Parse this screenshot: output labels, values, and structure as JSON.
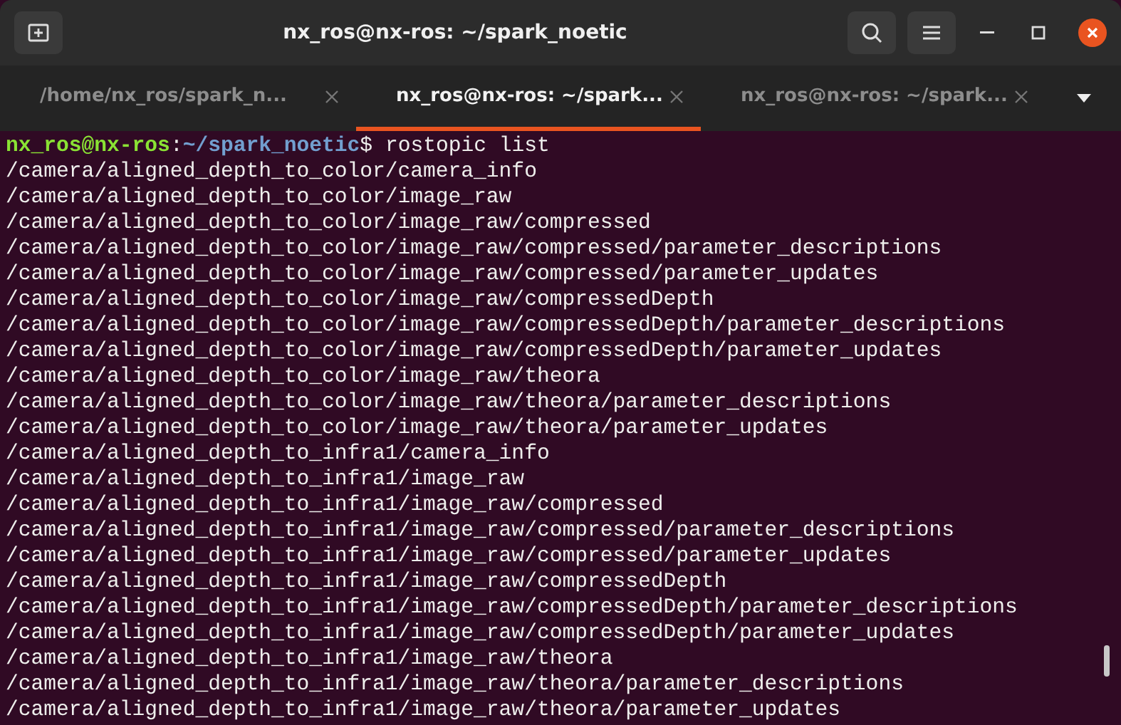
{
  "window": {
    "title": "nx_ros@nx-ros: ~/spark_noetic"
  },
  "tabs": [
    {
      "label": "/home/nx_ros/spark_n...",
      "selected": false
    },
    {
      "label": "nx_ros@nx-ros: ~/spark...",
      "selected": true
    },
    {
      "label": "nx_ros@nx-ros: ~/spark...",
      "selected": false
    }
  ],
  "terminal": {
    "prompt": {
      "user_host": "nx_ros@nx-ros",
      "separator": ":",
      "path": "~/spark_noetic",
      "symbol": "$",
      "command": "rostopic list"
    },
    "lines": [
      "/camera/aligned_depth_to_color/camera_info",
      "/camera/aligned_depth_to_color/image_raw",
      "/camera/aligned_depth_to_color/image_raw/compressed",
      "/camera/aligned_depth_to_color/image_raw/compressed/parameter_descriptions",
      "/camera/aligned_depth_to_color/image_raw/compressed/parameter_updates",
      "/camera/aligned_depth_to_color/image_raw/compressedDepth",
      "/camera/aligned_depth_to_color/image_raw/compressedDepth/parameter_descriptions",
      "/camera/aligned_depth_to_color/image_raw/compressedDepth/parameter_updates",
      "/camera/aligned_depth_to_color/image_raw/theora",
      "/camera/aligned_depth_to_color/image_raw/theora/parameter_descriptions",
      "/camera/aligned_depth_to_color/image_raw/theora/parameter_updates",
      "/camera/aligned_depth_to_infra1/camera_info",
      "/camera/aligned_depth_to_infra1/image_raw",
      "/camera/aligned_depth_to_infra1/image_raw/compressed",
      "/camera/aligned_depth_to_infra1/image_raw/compressed/parameter_descriptions",
      "/camera/aligned_depth_to_infra1/image_raw/compressed/parameter_updates",
      "/camera/aligned_depth_to_infra1/image_raw/compressedDepth",
      "/camera/aligned_depth_to_infra1/image_raw/compressedDepth/parameter_descriptions",
      "/camera/aligned_depth_to_infra1/image_raw/compressedDepth/parameter_updates",
      "/camera/aligned_depth_to_infra1/image_raw/theora",
      "/camera/aligned_depth_to_infra1/image_raw/theora/parameter_descriptions",
      "/camera/aligned_depth_to_infra1/image_raw/theora/parameter_updates"
    ]
  }
}
